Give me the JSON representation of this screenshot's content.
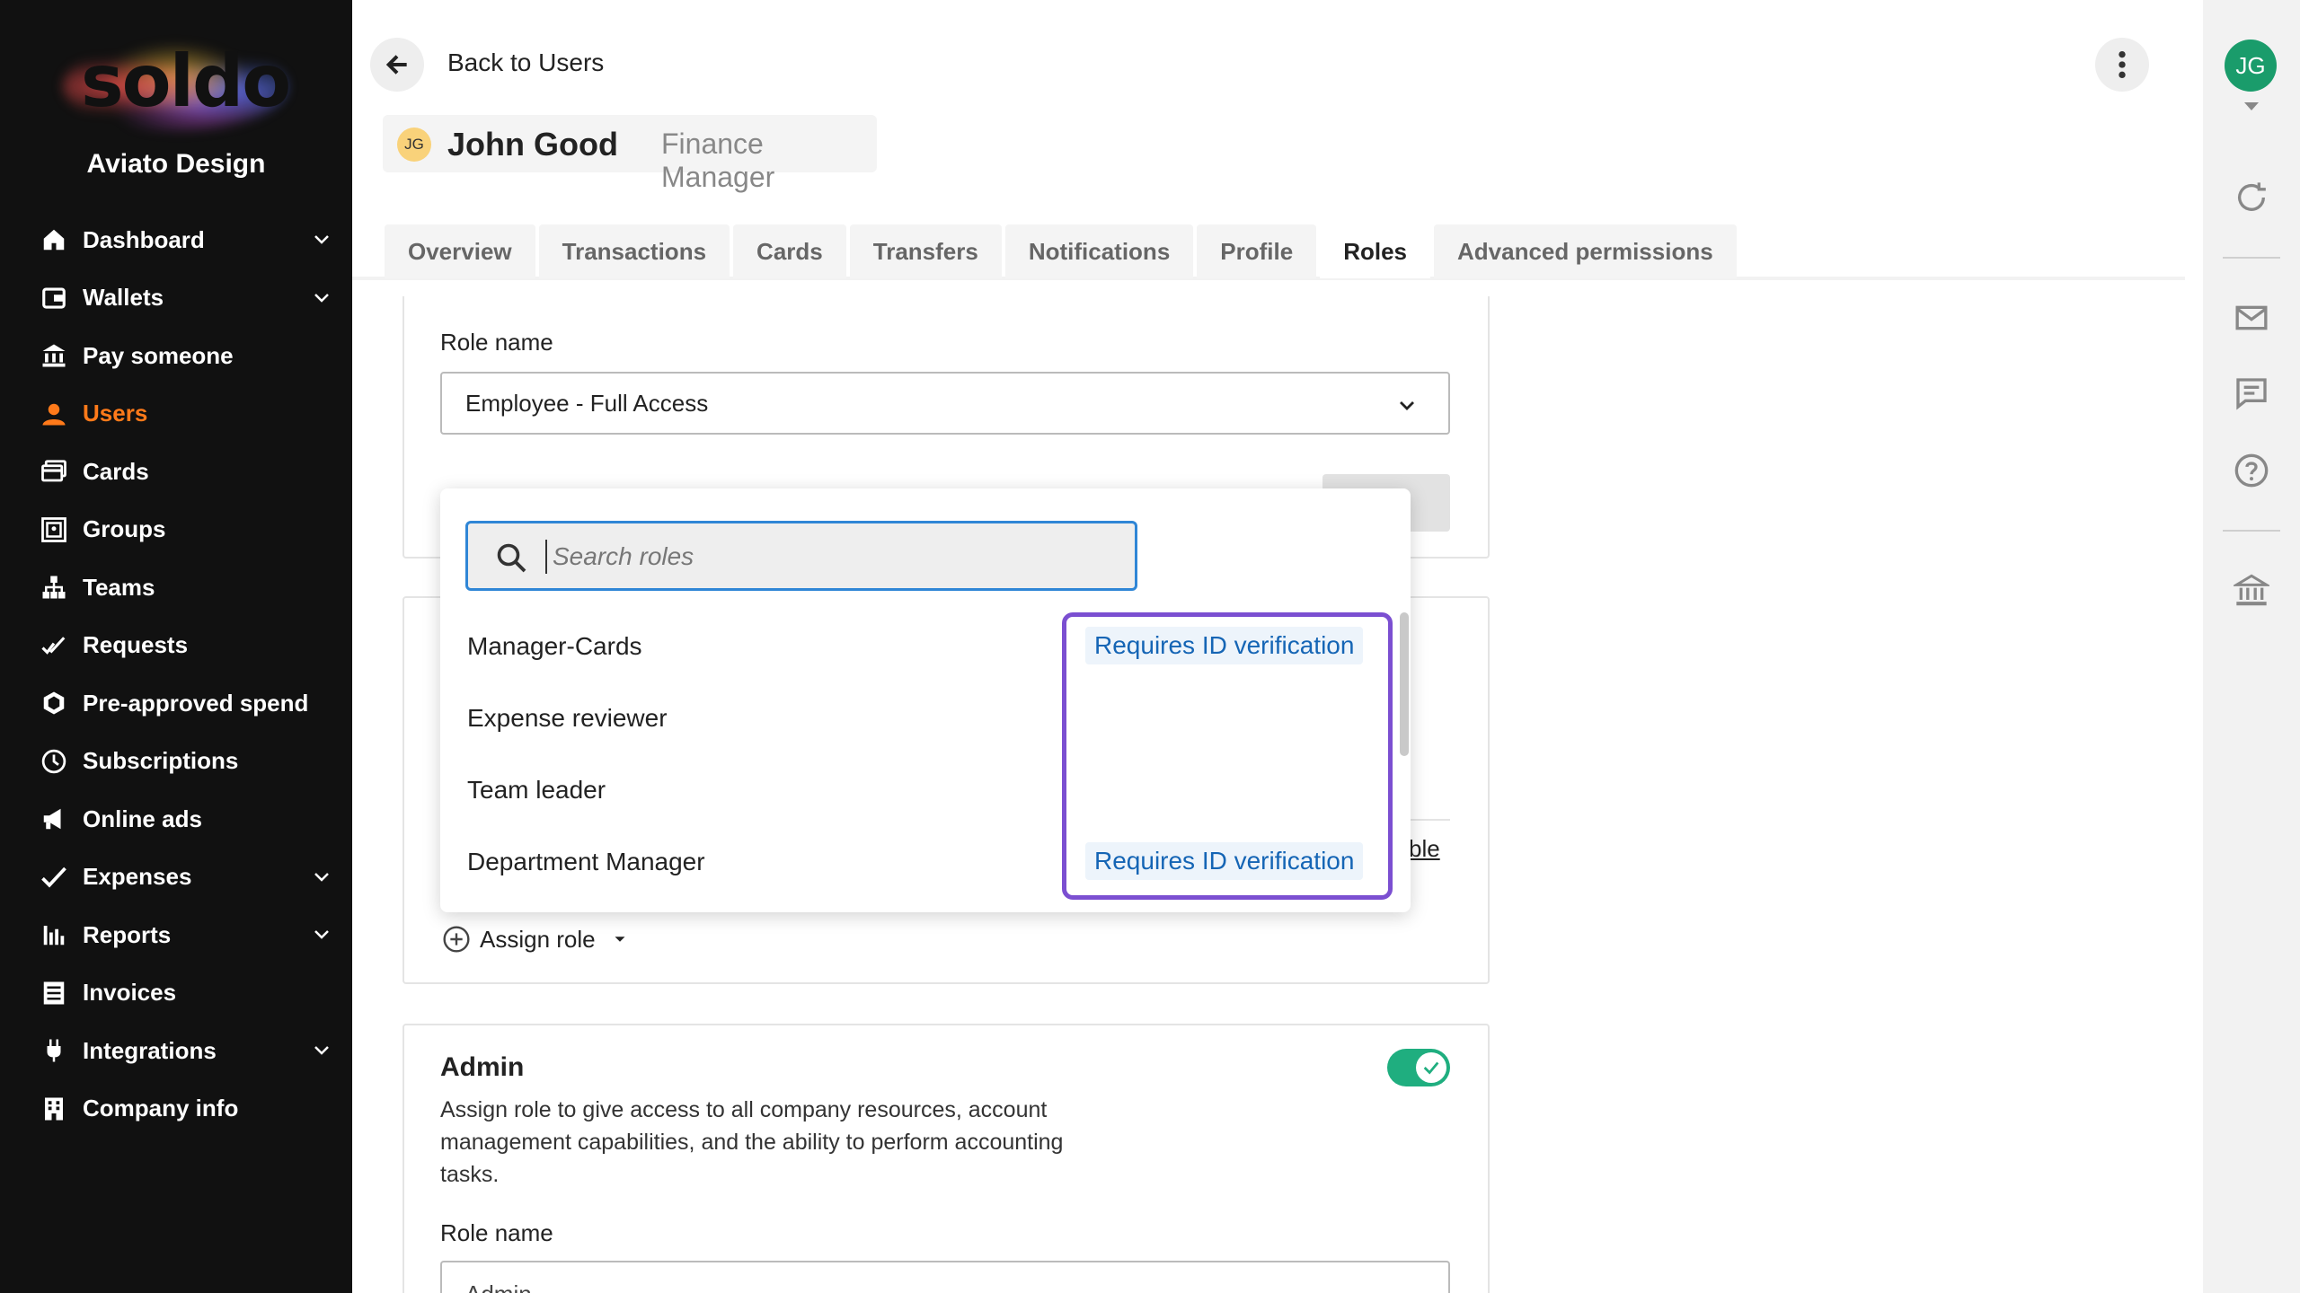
{
  "sidebar": {
    "logo_text": "soldo",
    "org_name": "Aviato Design",
    "items": [
      {
        "label": "Dashboard",
        "icon": "home-icon",
        "has_chevron": true
      },
      {
        "label": "Wallets",
        "icon": "wallet-icon",
        "has_chevron": true
      },
      {
        "label": "Pay someone",
        "icon": "bank-icon",
        "has_chevron": false
      },
      {
        "label": "Users",
        "icon": "user-icon",
        "has_chevron": false,
        "active": true
      },
      {
        "label": "Cards",
        "icon": "cards-icon",
        "has_chevron": false
      },
      {
        "label": "Groups",
        "icon": "groups-icon",
        "has_chevron": false
      },
      {
        "label": "Teams",
        "icon": "teams-icon",
        "has_chevron": false
      },
      {
        "label": "Requests",
        "icon": "requests-icon",
        "has_chevron": false
      },
      {
        "label": "Pre-approved spend",
        "icon": "hexagon-icon",
        "has_chevron": false
      },
      {
        "label": "Subscriptions",
        "icon": "clock-icon",
        "has_chevron": false
      },
      {
        "label": "Online ads",
        "icon": "megaphone-icon",
        "has_chevron": false
      },
      {
        "label": "Expenses",
        "icon": "checkmark-icon",
        "has_chevron": true
      },
      {
        "label": "Reports",
        "icon": "bar-chart-icon",
        "has_chevron": true
      },
      {
        "label": "Invoices",
        "icon": "invoice-icon",
        "has_chevron": false
      },
      {
        "label": "Integrations",
        "icon": "plug-icon",
        "has_chevron": true
      },
      {
        "label": "Company info",
        "icon": "building-icon",
        "has_chevron": false
      }
    ],
    "active_color": "#ff7a1a"
  },
  "header": {
    "back_label": "Back to Users",
    "user": {
      "initials": "JG",
      "name": "John Good",
      "role": "Finance Manager"
    }
  },
  "tabs": [
    {
      "label": "Overview"
    },
    {
      "label": "Transactions"
    },
    {
      "label": "Cards"
    },
    {
      "label": "Transfers"
    },
    {
      "label": "Notifications"
    },
    {
      "label": "Profile"
    },
    {
      "label": "Roles",
      "active": true
    },
    {
      "label": "Advanced permissions"
    }
  ],
  "roles_card": {
    "role_label": "Role name",
    "selected_role": "Employee - Full Access",
    "partial_link_text": "ble"
  },
  "dropdown": {
    "search_placeholder": "Search roles",
    "options": [
      {
        "label": "Manager-Cards",
        "badge": "Requires ID verification"
      },
      {
        "label": "Expense reviewer",
        "badge": ""
      },
      {
        "label": "Team leader",
        "badge": ""
      },
      {
        "label": "Department Manager",
        "badge": "Requires ID verification"
      }
    ],
    "highlight_color": "#7b4fd1",
    "badge_color": "#1565b5"
  },
  "assign_role_label": "Assign role",
  "admin_card": {
    "title": "Admin",
    "description": "Assign role to give access to all company resources, account management capabilities, and the ability to perform accounting tasks.",
    "toggle_on": true,
    "role_label": "Role name",
    "selected_role": "Admin",
    "toggle_color": "#1fae7f"
  },
  "right_rail": {
    "avatar_initials": "JG",
    "avatar_color": "#1a9c6b",
    "icons": [
      "refresh-icon",
      "mail-icon",
      "chat-icon",
      "help-icon",
      "bank-icon"
    ]
  }
}
